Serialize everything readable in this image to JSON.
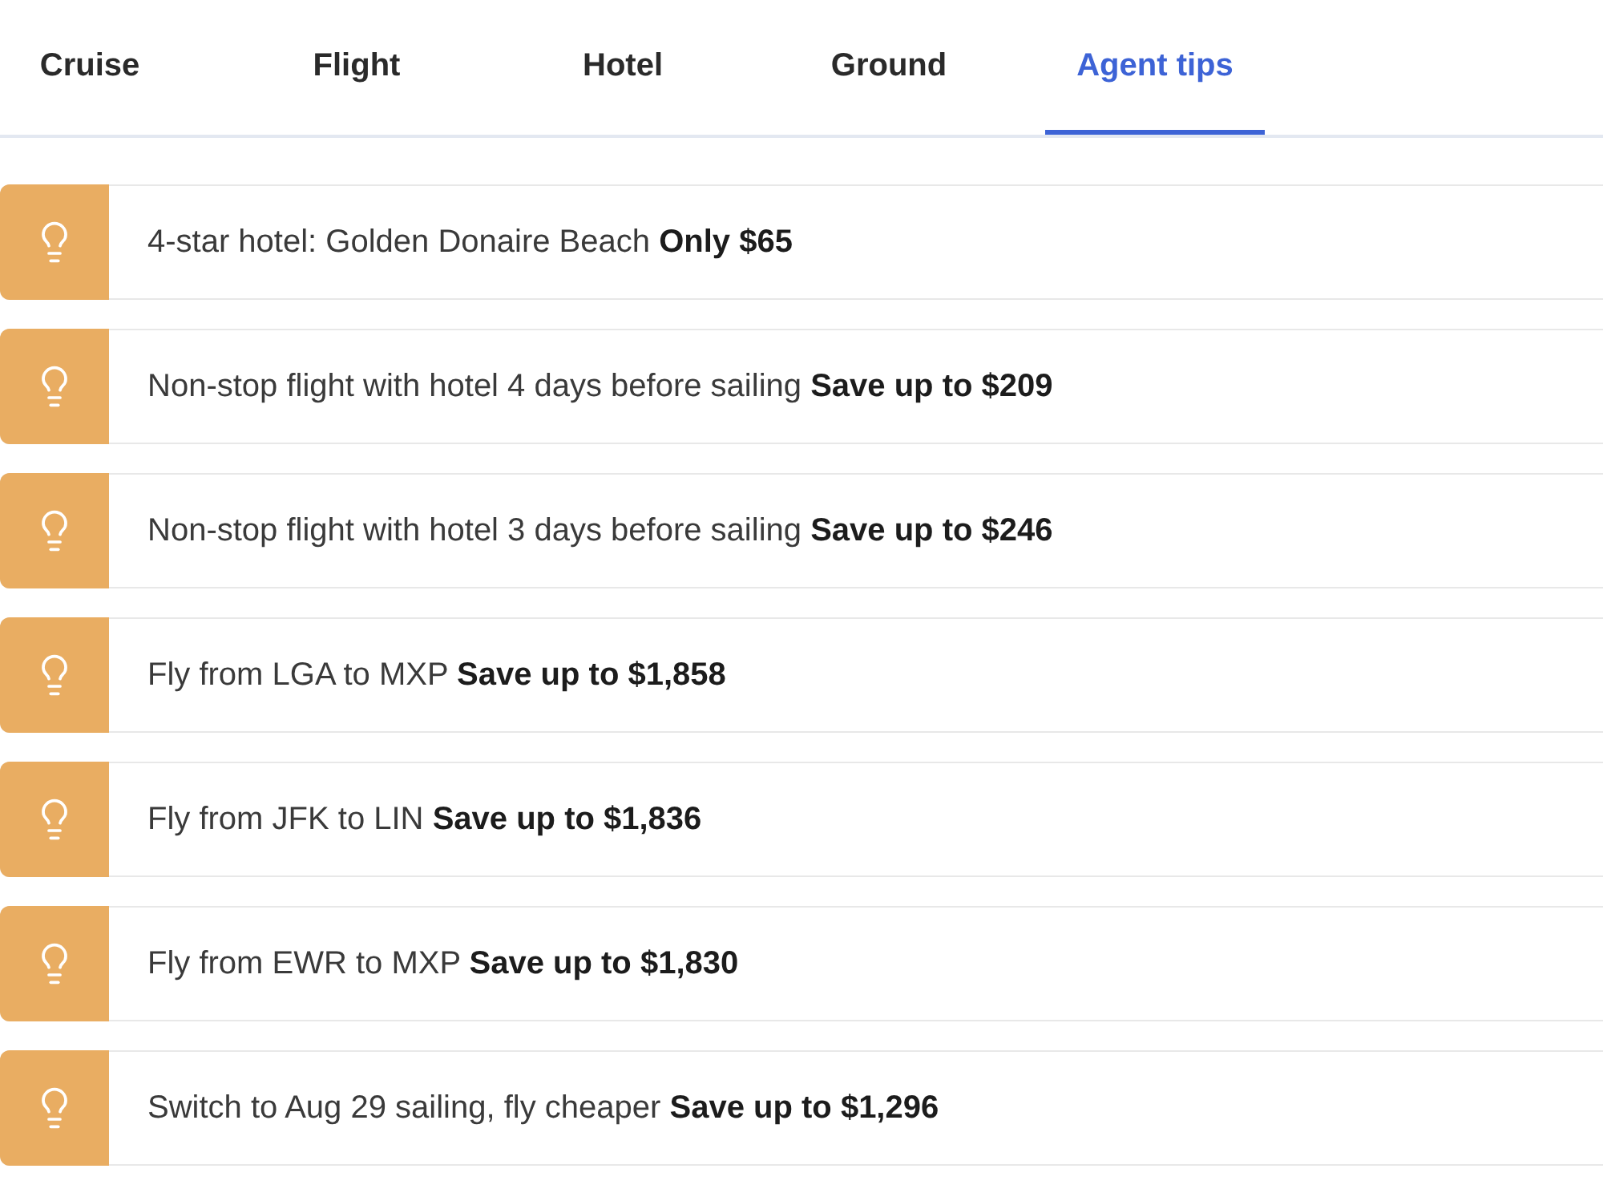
{
  "tabs": [
    {
      "label": "Cruise",
      "selected": false
    },
    {
      "label": "Flight",
      "selected": false
    },
    {
      "label": "Hotel",
      "selected": false
    },
    {
      "label": "Ground",
      "selected": false
    },
    {
      "label": "Agent tips",
      "selected": true
    }
  ],
  "tips": [
    {
      "text": "4-star hotel: Golden Donaire Beach **Only $65**"
    },
    {
      "text": "Non-stop flight with hotel 4 days before sailing **Save up to $209**"
    },
    {
      "text": "Non-stop flight with hotel 3 days before sailing **Save up to $246**"
    },
    {
      "text": "Fly from LGA to MXP **Save up to $1,858**"
    },
    {
      "text": "Fly from JFK to LIN **Save up to $1,836**"
    },
    {
      "text": "Fly from EWR to MXP **Save up to $1,830**"
    },
    {
      "text": "Switch to Aug 29 sailing, fly cheaper **Save up to $1,296**"
    }
  ]
}
